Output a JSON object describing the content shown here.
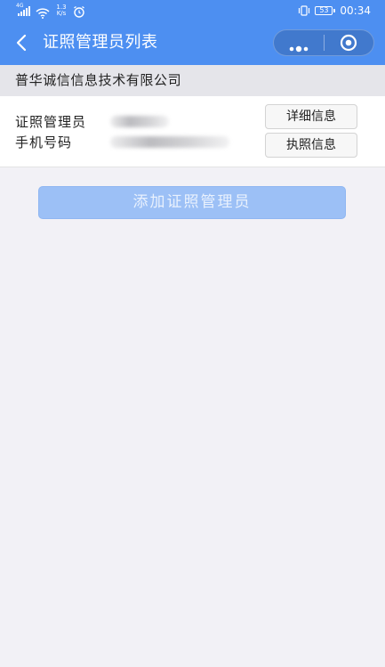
{
  "status_bar": {
    "network_label": "4G",
    "speed_value": "1.3",
    "speed_unit": "K/s",
    "battery_level": "53",
    "time": "00:34"
  },
  "navbar": {
    "title": "证照管理员列表",
    "back_icon": "chevron-left-icon",
    "more_icon": "more-dots-icon",
    "close_icon": "target-circle-icon"
  },
  "company": {
    "name": "普华诚信信息技术有限公司"
  },
  "admin": {
    "name_label": "证照管理员",
    "phone_label": "手机号码",
    "details_button": "详细信息",
    "license_button": "执照信息"
  },
  "add_button": "添加证照管理员",
  "colors": {
    "nav_bg": "#4d8ff1",
    "page_bg": "#f2f1f6",
    "add_button_bg": "#9cc0f6"
  }
}
